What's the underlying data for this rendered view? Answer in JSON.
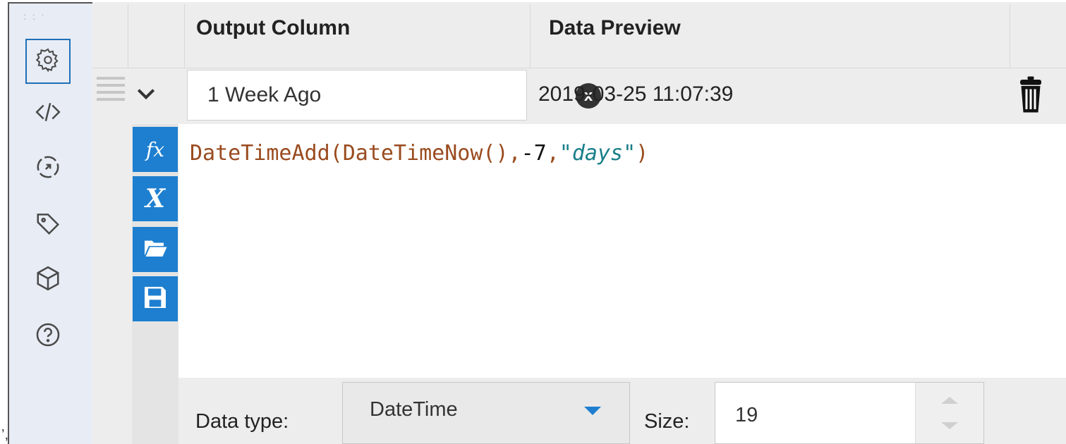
{
  "rail": {
    "grip": "· · · · ·",
    "icons": [
      "gear-icon",
      "code-icon",
      "target-icon",
      "tag-icon",
      "cube-icon",
      "help-icon"
    ],
    "stray_mark": "’,"
  },
  "grid": {
    "headers": {
      "output_column": "Output Column",
      "data_preview": "Data Preview"
    }
  },
  "row": {
    "name_value": "1 Week Ago",
    "clear_label": "x",
    "preview_value": "2019-03-25 11:07:39"
  },
  "tools": {
    "fx_label": "fx",
    "var_label": "X"
  },
  "expression": {
    "parts": {
      "fn": "DateTimeAdd(DateTimeNow(),",
      "num": "-7",
      "sep": ",",
      "str": "\"days\"",
      "close": ")"
    }
  },
  "bottom": {
    "data_type_label": "Data type:",
    "data_type_value": "DateTime",
    "size_label": "Size:",
    "size_value": "19"
  },
  "colors": {
    "accent": "#1e7fd0",
    "rail_bg": "#e8ecf5",
    "function_color": "#9a4b1f",
    "string_color": "#1a7f8a"
  }
}
